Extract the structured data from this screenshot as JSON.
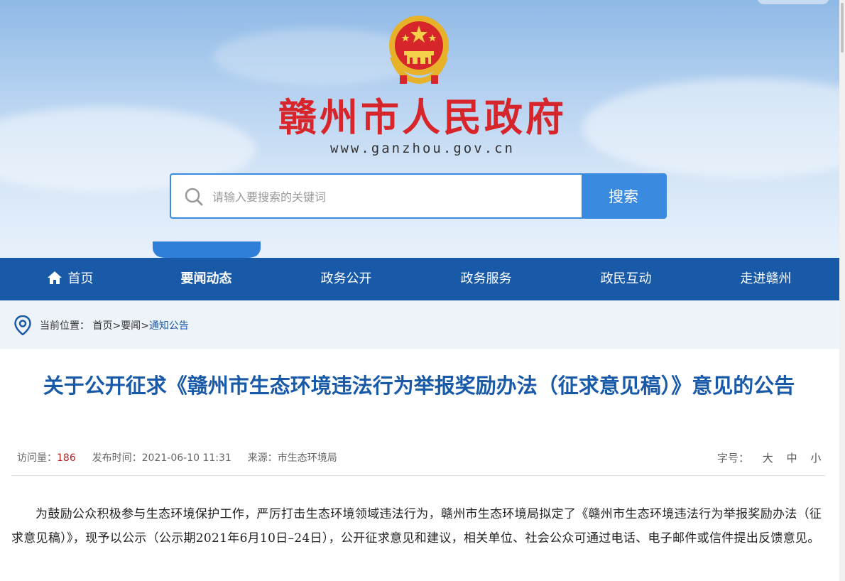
{
  "header": {
    "site_title": "赣州市人民政府",
    "site_url": "www.ganzhou.gov.cn",
    "emblem_icon": "national-emblem-icon"
  },
  "search": {
    "placeholder": "请输入要搜索的关键词",
    "value": "",
    "button_label": "搜索"
  },
  "nav": {
    "items": [
      {
        "label": "首页",
        "icon": "home-icon"
      },
      {
        "label": "要闻动态",
        "active": true
      },
      {
        "label": "政务公开"
      },
      {
        "label": "政务服务"
      },
      {
        "label": "政民互动"
      },
      {
        "label": "走进赣州"
      }
    ]
  },
  "breadcrumb": {
    "prefix": "当前位置：",
    "items": [
      "首页",
      "要闻",
      "通知公告"
    ],
    "separator": ">"
  },
  "article": {
    "title": "关于公开征求《赣州市生态环境违法行为举报奖励办法（征求意见稿）》意见的公告",
    "views_label": "访问量：",
    "views": "186",
    "published_label": "发布时间：",
    "published": "2021-06-10 11:31",
    "source_label": "来源：",
    "source": "市生态环境局",
    "font_size_label": "字号：",
    "font_sizes": [
      "大",
      "中",
      "小"
    ],
    "paragraph": "为鼓励公众积极参与生态环境保护工作，严厉打击生态环境领域违法行为，赣州市生态环境局拟定了《赣州市生态环境违法行为举报奖励办法（征求意见稿）》，现予以公示（公示期2021年6月10日–24日），公开征求意见和建议，相关单位、社会公众可通过电话、电子邮件或信件提出反馈意见。"
  },
  "colors": {
    "nav_bg": "#1859a8",
    "title_red": "#d7262b",
    "accent_blue": "#3a8ae0",
    "views_red": "#b22222"
  }
}
